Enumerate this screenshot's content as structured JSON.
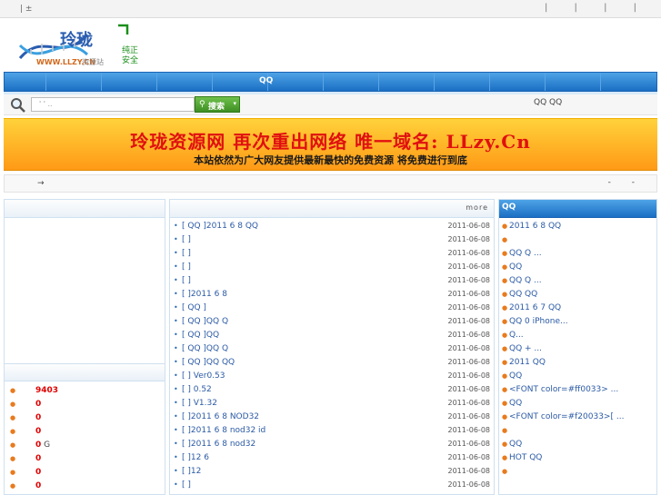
{
  "topbar": {
    "left_text": "| ±",
    "right_text": "| | | |"
  },
  "logo": {
    "brand": "玲珑",
    "tag1": "纯正",
    "tag2": "安全",
    "url": "WWW.LLZY.CN",
    "sub": "资源站"
  },
  "nav": {
    "center_label": "QQ"
  },
  "search": {
    "placeholder": "' ' ..",
    "button_label": "搜索",
    "dropdown_glyph": "▾",
    "right_links": "QQ  QQ"
  },
  "banner": {
    "headline": "玲珑资源网 再次重出网络 唯一域名: LLzy.Cn",
    "subline": "本站依然为广大网友提供最新最快的免费资源 将免费进行到底"
  },
  "notice": {
    "arrow": "→",
    "right_text": "- -"
  },
  "stats": {
    "items": [
      {
        "value": "9403",
        "suffix": ""
      },
      {
        "value": "0",
        "suffix": ""
      },
      {
        "value": "0",
        "suffix": ""
      },
      {
        "value": "0",
        "suffix": ""
      },
      {
        "value": "0",
        "suffix": " G"
      },
      {
        "value": "0",
        "suffix": ""
      },
      {
        "value": "0",
        "suffix": ""
      },
      {
        "value": "0",
        "suffix": ""
      }
    ]
  },
  "mid": {
    "more_label": "more",
    "items": [
      {
        "title": "[ QQ ]2011 6 8     QQ",
        "date": "2011-06-08"
      },
      {
        "title": "[ ]",
        "date": "2011-06-08"
      },
      {
        "title": "[ ]",
        "date": "2011-06-08"
      },
      {
        "title": "[ ]",
        "date": "2011-06-08"
      },
      {
        "title": "[ ]",
        "date": "2011-06-08"
      },
      {
        "title": "[ ]2011 6 8",
        "date": "2011-06-08"
      },
      {
        "title": "[ QQ ]",
        "date": "2011-06-08"
      },
      {
        "title": "[ QQ ]QQ      Q",
        "date": "2011-06-08"
      },
      {
        "title": "[ QQ ]QQ",
        "date": "2011-06-08"
      },
      {
        "title": "[ QQ ]QQ           Q",
        "date": "2011-06-08"
      },
      {
        "title": "[ QQ ]QQ          QQ",
        "date": "2011-06-08"
      },
      {
        "title": "[ ]    Ver0.53",
        "date": "2011-06-08"
      },
      {
        "title": "[ ]       0.52",
        "date": "2011-06-08"
      },
      {
        "title": "[ ]    V1.32",
        "date": "2011-06-08"
      },
      {
        "title": "[ ]2011 6 8 NOD32",
        "date": "2011-06-08"
      },
      {
        "title": "[ ]2011 6 8  nod32  id",
        "date": "2011-06-08"
      },
      {
        "title": "[ ]2011 6 8 nod32",
        "date": "2011-06-08"
      },
      {
        "title": "[ ]12  6",
        "date": "2011-06-08"
      },
      {
        "title": "[ ]12",
        "date": "2011-06-08"
      },
      {
        "title": "[ ]",
        "date": "2011-06-08"
      }
    ]
  },
  "right": {
    "title": "QQ",
    "items": [
      "2011 6 8      QQ",
      "",
      "QQ      Q        ...",
      "QQ",
      "QQ            Q ...",
      "QQ          QQ",
      "2011 6 7      QQ",
      "QQ   0      iPhone...",
      "           Q...",
      "QQ              + ...",
      "2011  QQ",
      "     QQ",
      "<FONT color=#ff0033>   ...",
      "     QQ",
      "<FONT color=#f20033>[ ...",
      "",
      "QQ",
      "   HOT    QQ",
      ""
    ]
  },
  "colors": {
    "nav_blue": "#1a6fc4",
    "banner_orange": "#ff9a16",
    "headline_red": "#e01010",
    "stat_red": "#e00000",
    "link_blue": "#2b5aa5",
    "search_green": "#3e8f23"
  }
}
